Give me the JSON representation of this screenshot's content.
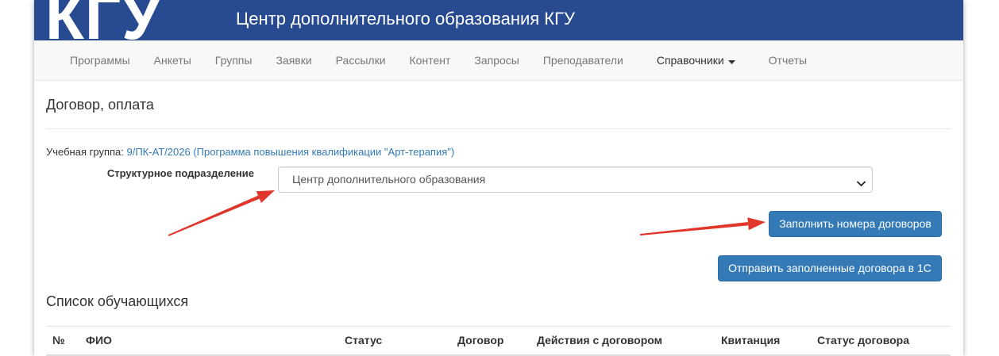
{
  "header": {
    "logo_text": "КГУ",
    "title": "Центр дополнительного образования КГУ"
  },
  "nav": {
    "items": [
      {
        "label": "Программы"
      },
      {
        "label": "Анкеты"
      },
      {
        "label": "Группы"
      },
      {
        "label": "Заявки"
      },
      {
        "label": "Рассылки"
      },
      {
        "label": "Контент"
      },
      {
        "label": "Запросы"
      },
      {
        "label": "Преподаватели"
      },
      {
        "label": "Справочники",
        "icon": "caret-down-icon"
      },
      {
        "label": "Отчеты"
      }
    ]
  },
  "contract": {
    "title": "Договор, оплата",
    "group_label": "Учебная группа:",
    "group_link": "9/ПК-АТ/2026 (Программа повышения квалификации \"Арт-терапия\")",
    "department_label": "Структурное подразделение",
    "department_select": {
      "value": "Центр дополнительного образования",
      "icon": "chevron-down-icon"
    },
    "fill_numbers_button": "Заполнить номера договоров",
    "send_to_1c_button": "Отправить заполненные договора в 1С"
  },
  "students": {
    "title": "Список обучающихся",
    "columns": [
      "№",
      "ФИО",
      "Статус",
      "Договор",
      "Действия с договором",
      "Квитанция",
      "Статус договора"
    ]
  },
  "colors": {
    "header_bg": "#284a91",
    "nav_bg": "#f8f8f8",
    "accent": "#337ab7",
    "annotation_arrow": "#e0362c"
  }
}
